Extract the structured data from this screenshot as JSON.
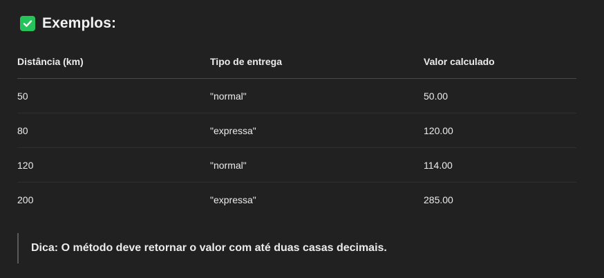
{
  "heading": {
    "icon": "check-box-icon",
    "icon_color": "#25c45a",
    "text": "Exemplos:"
  },
  "table": {
    "headers": [
      "Distância (km)",
      "Tipo de entrega",
      "Valor calculado"
    ],
    "rows": [
      [
        "50",
        "\"normal\"",
        "50.00"
      ],
      [
        "80",
        "\"expressa\"",
        "120.00"
      ],
      [
        "120",
        "\"normal\"",
        "114.00"
      ],
      [
        "200",
        "\"expressa\"",
        "285.00"
      ]
    ]
  },
  "tip": {
    "text": "Dica: O método deve retornar o valor com até duas casas decimais."
  }
}
